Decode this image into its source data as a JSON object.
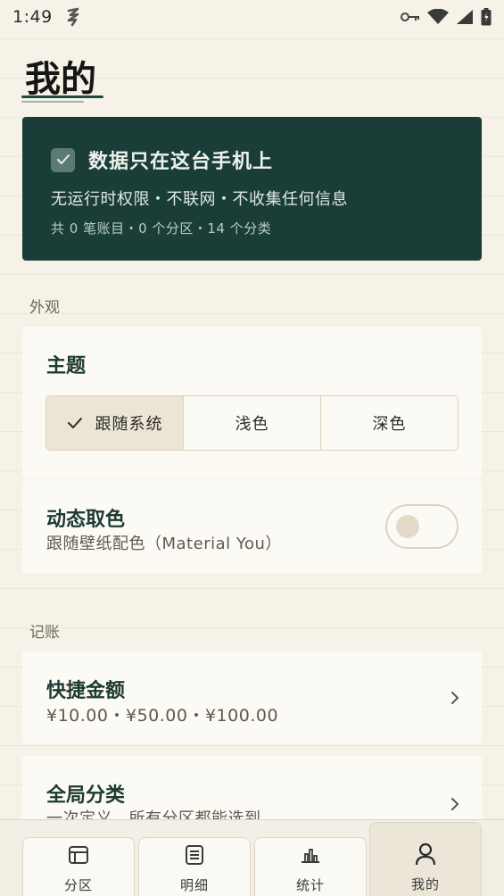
{
  "status_bar": {
    "time": "1:49",
    "icons": [
      "notification-icon",
      "key-icon",
      "wifi-icon",
      "signal-icon",
      "battery-icon"
    ]
  },
  "page": {
    "title": "我的"
  },
  "privacy": {
    "title": "数据只在这台手机上",
    "subtitle": "无运行时权限・不联网・不收集任何信息",
    "stats": "共 0 笔账目・0 个分区・14 个分类"
  },
  "appearance": {
    "section_label": "外观",
    "theme": {
      "title": "主题",
      "options": [
        "跟随系统",
        "浅色",
        "深色"
      ],
      "selected": "跟随系统"
    },
    "dynamic_color": {
      "title": "动态取色",
      "subtitle": "跟随壁纸配色（Material You）",
      "enabled": false
    }
  },
  "bookkeeping": {
    "section_label": "记账",
    "quick_amount": {
      "title": "快捷金额",
      "subtitle": "¥10.00・¥50.00・¥100.00"
    },
    "global_category": {
      "title": "全局分类",
      "subtitle": "一次定义，所有分区都能选到"
    }
  },
  "nav": {
    "items": [
      {
        "label": "分区",
        "icon": "partition-icon"
      },
      {
        "label": "明细",
        "icon": "list-icon"
      },
      {
        "label": "统计",
        "icon": "stats-icon"
      },
      {
        "label": "我的",
        "icon": "person-icon"
      }
    ],
    "active": "我的"
  },
  "colors": {
    "background": "#f6f2e7",
    "accent": "#1a3e37",
    "card": "#fcfaf4",
    "border": "#ddd3bf"
  }
}
